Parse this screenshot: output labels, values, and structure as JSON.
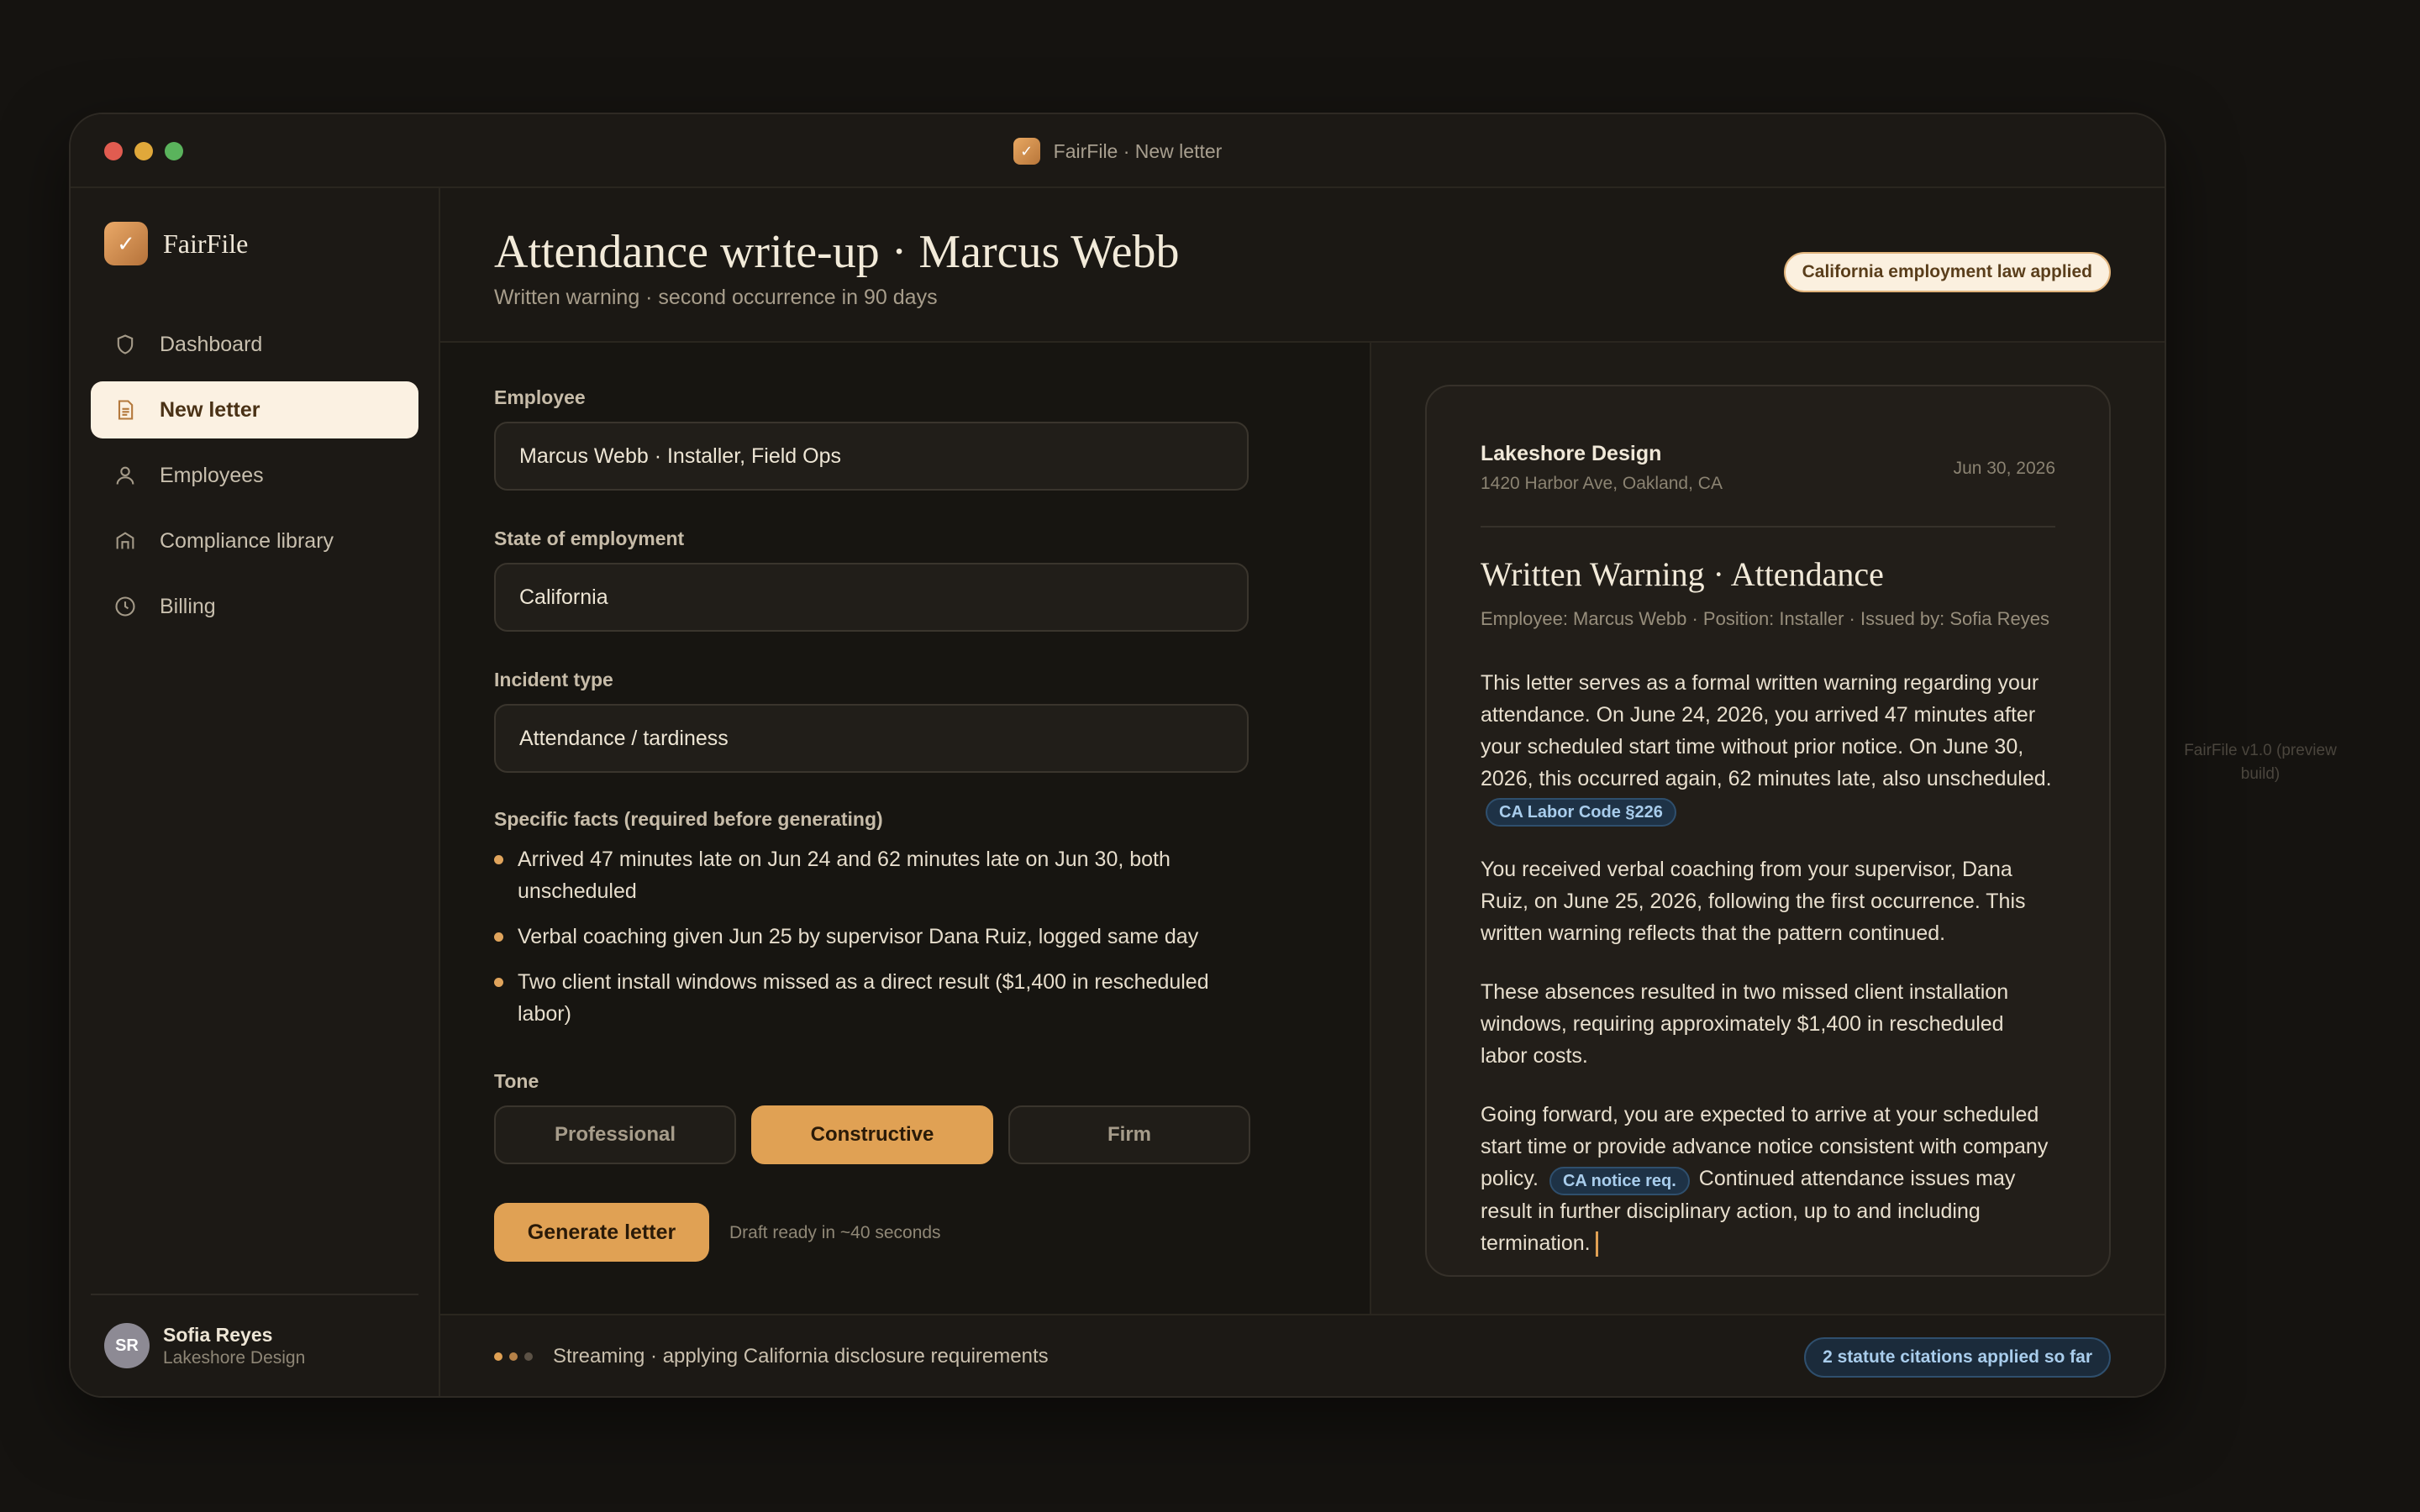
{
  "window": {
    "title": "FairFile · New letter"
  },
  "sidebar": {
    "brand": "FairFile",
    "items": [
      {
        "label": "Dashboard",
        "icon": "shield-icon",
        "active": false
      },
      {
        "label": "New letter",
        "icon": "document-icon",
        "active": true
      },
      {
        "label": "Employees",
        "icon": "person-icon",
        "active": false
      },
      {
        "label": "Compliance library",
        "icon": "library-icon",
        "active": false
      },
      {
        "label": "Billing",
        "icon": "clock-icon",
        "active": false
      }
    ],
    "user": {
      "initials": "SR",
      "name": "Sofia Reyes",
      "org": "Lakeshore Design"
    }
  },
  "header": {
    "title": "Attendance write-up · Marcus Webb",
    "subtitle": "Written warning · second occurrence in 90 days",
    "badge": "California employment law applied"
  },
  "form": {
    "employee_label": "Employee",
    "employee_value": "Marcus Webb · Installer, Field Ops",
    "state_label": "State of employment",
    "state_value": "California",
    "incident_label": "Incident type",
    "incident_value": "Attendance / tardiness",
    "facts_label": "Specific facts (required before generating)",
    "facts": [
      "Arrived 47 minutes late on Jun 24 and 62 minutes late on Jun 30, both unscheduled",
      "Verbal coaching given Jun 25 by supervisor Dana Ruiz, logged same day",
      "Two client install windows missed as a direct result ($1,400 in rescheduled labor)"
    ],
    "tone_label": "Tone",
    "tones": [
      "Professional",
      "Constructive",
      "Firm"
    ],
    "tone_selected": "Constructive",
    "generate_label": "Generate letter",
    "generate_note": "Draft ready in ~40 seconds"
  },
  "letter": {
    "company": "Lakeshore Design",
    "address": "1420 Harbor Ave, Oakland, CA",
    "date": "Jun 30, 2026",
    "title": "Written Warning · Attendance",
    "meta": "Employee: Marcus Webb · Position: Installer · Issued by: Sofia Reyes",
    "p1": "This letter serves as a formal written warning regarding your attendance. On June 24, 2026, you arrived 47 minutes after your scheduled start time without prior notice. On June 30, 2026, this occurred again, 62 minutes late, also unscheduled.",
    "cite1": "CA Labor Code §226",
    "p2": "You received verbal coaching from your supervisor, Dana Ruiz, on June 25, 2026, following the first occurrence. This written warning reflects that the pattern continued.",
    "p3": "These absences resulted in two missed client installation windows, requiring approximately $1,400 in rescheduled labor costs.",
    "p4a": "Going forward, you are expected to arrive at your scheduled start time or provide advance notice consistent with company policy.",
    "cite2": "CA notice req.",
    "p4b": "Continued attendance issues may result in further disciplinary action, up to and including termination."
  },
  "status": {
    "text": "Streaming · applying California disclosure requirements",
    "citations": "2 statute citations applied so far"
  },
  "footer": {
    "version": "FairFile v1.0 (preview build)"
  },
  "colors": {
    "accent": "#e0a154",
    "background": "#151310",
    "citation": "#a9cdec"
  }
}
